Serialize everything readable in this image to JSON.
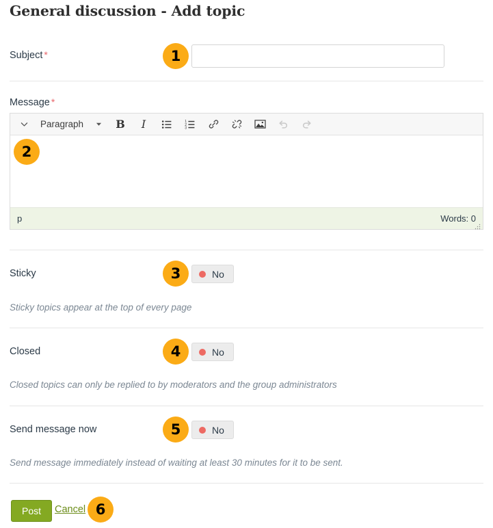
{
  "page": {
    "title": "General discussion - Add topic"
  },
  "fields": {
    "subject": {
      "label": "Subject",
      "required_marker": "*",
      "value": "",
      "placeholder": ""
    },
    "message": {
      "label": "Message",
      "required_marker": "*",
      "value": ""
    }
  },
  "editor": {
    "toolbar": {
      "collapse_icon": "chevron-down-icon",
      "format_label": "Paragraph",
      "format_caret": "▾",
      "bold_label": "B",
      "italic_label": "I",
      "bullet_list_icon": "bullet-list-icon",
      "numbered_list_icon": "numbered-list-icon",
      "link_icon": "link-icon",
      "unlink_icon": "unlink-icon",
      "image_icon": "image-icon",
      "undo_icon": "undo-icon",
      "redo_icon": "redo-icon"
    },
    "statusbar": {
      "element_path": "p",
      "word_count": "Words: 0",
      "resize_grip": "resize-grip-icon"
    }
  },
  "options": [
    {
      "label": "Sticky",
      "toggle_value": "No",
      "help": "Sticky topics appear at the top of every page"
    },
    {
      "label": "Closed",
      "toggle_value": "No",
      "help": "Closed topics can only be replied to by moderators and the group administrators"
    },
    {
      "label": "Send message now",
      "toggle_value": "No",
      "help": "Send message immediately instead of waiting at least 30 minutes for it to be sent."
    }
  ],
  "footer": {
    "post_label": "Post",
    "cancel_label": "Cancel"
  },
  "badges": {
    "one": "1",
    "two": "2",
    "three": "3",
    "four": "4",
    "five": "5",
    "six": "6"
  },
  "colors": {
    "badge": "#fbab16",
    "post_button": "#84a922",
    "cancel_link": "#6b8c18",
    "toggle_dot": "#ed6a63",
    "required_marker": "#e8656a",
    "statusbar_bg": "#eef4e5"
  }
}
